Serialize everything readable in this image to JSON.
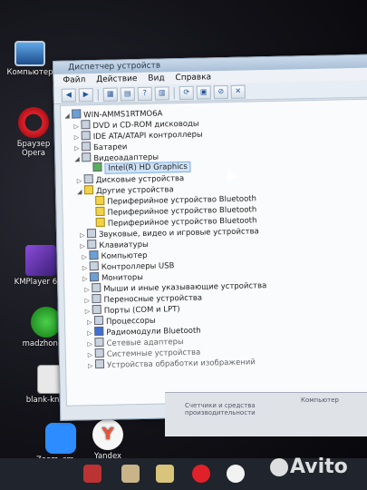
{
  "desktop": {
    "icons": [
      {
        "label": "Компьютер"
      },
      {
        "label": "Браузер Opera"
      },
      {
        "label": "KMPlayer 64X"
      },
      {
        "label": "madzhong..."
      },
      {
        "label": "blank-knig..."
      },
      {
        "label": "Zoom_cm_..."
      },
      {
        "label": "Yandex"
      }
    ]
  },
  "window": {
    "title": "Диспетчер устройств",
    "menu": [
      "Файл",
      "Действие",
      "Вид",
      "Справка"
    ],
    "tree": {
      "root": "WIN-AMMS1RTMO6A",
      "nodes": [
        "DVD и CD-ROM дисководы",
        "IDE ATA/ATAPI контроллеры",
        "Батареи",
        "Видеоадаптеры",
        "Intel(R) HD Graphics",
        "Дисковые устройства",
        "Другие устройства",
        "Периферийное устройство Bluetooth",
        "Периферийное устройство Bluetooth",
        "Периферийное устройство Bluetooth",
        "Звуковые, видео и игровые устройства",
        "Клавиатуры",
        "Компьютер",
        "Контроллеры USB",
        "Мониторы",
        "Мыши и иные указывающие устройства",
        "Переносные устройства",
        "Порты (COM и LPT)",
        "Процессоры",
        "Радиомодули Bluetooth",
        "Сетевые адаптеры",
        "Системные устройства",
        "Устройства обработки изображений"
      ]
    }
  },
  "pane2": {
    "left_text": "Счетчики и средства производительности",
    "right_text": "Компьютер"
  },
  "watermark": "Avito"
}
